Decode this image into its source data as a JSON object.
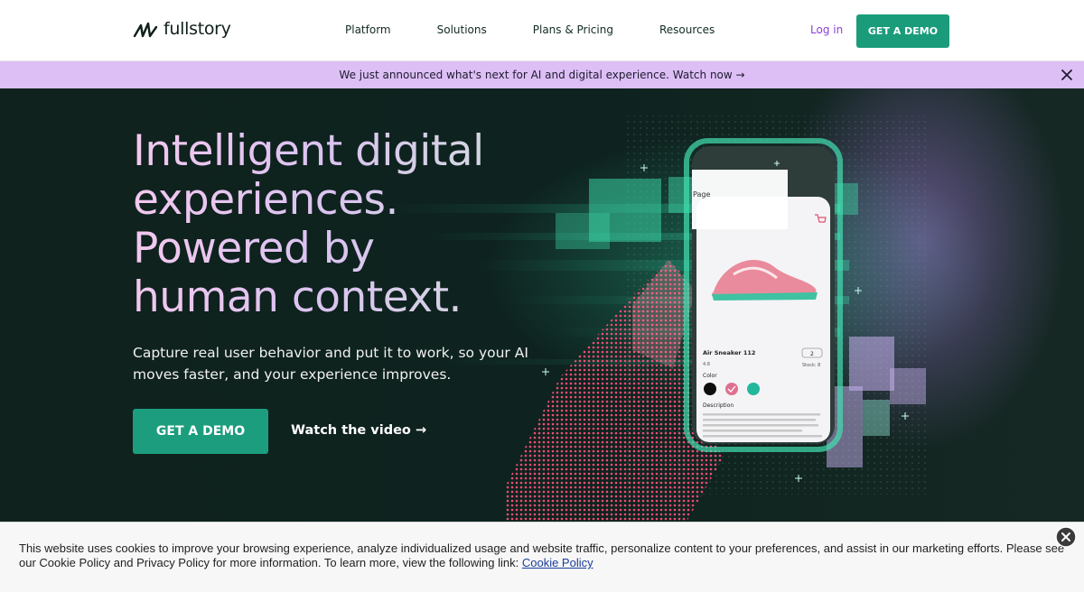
{
  "nav": {
    "logo_text": "fullstory",
    "links": [
      "Platform",
      "Solutions",
      "Plans & Pricing",
      "Resources"
    ],
    "login": "Log in",
    "demo": "GET A DEMO"
  },
  "announcement": {
    "text": "We just announced what's next for AI and digital experience. Watch now →"
  },
  "hero": {
    "headline": [
      "Intelligent digital",
      "experiences.",
      "Powered by",
      "human context."
    ],
    "subhead": "Capture real user behavior and put it to work, so your AI moves faster, and your experience improves.",
    "demo_button": "GET A DEMO",
    "watch": "Watch the video →"
  },
  "phone": {
    "page_label": "Page",
    "product_name": "Air Sneaker 112",
    "rating": "4.8",
    "quantity": "2",
    "stock": "Stock: 8",
    "color_label": "Color",
    "description_label": "Description",
    "swatches": [
      "#0d0d0d",
      "#e07091",
      "#23b89b"
    ]
  },
  "cookie": {
    "text": "This website uses cookies to improve your browsing experience, analyze individualized usage and website traffic, personalize content to your preferences, and assist in our marketing efforts. Please see our Cookie Policy and Privacy Policy for more information. To learn more, view the following link:",
    "link": "Cookie Policy"
  },
  "colors": {
    "brand_green": "#1a9c7b",
    "announce_bg": "#ddbff6",
    "login_purple": "#8f3fd6",
    "hero_bg": "#0f221e"
  }
}
